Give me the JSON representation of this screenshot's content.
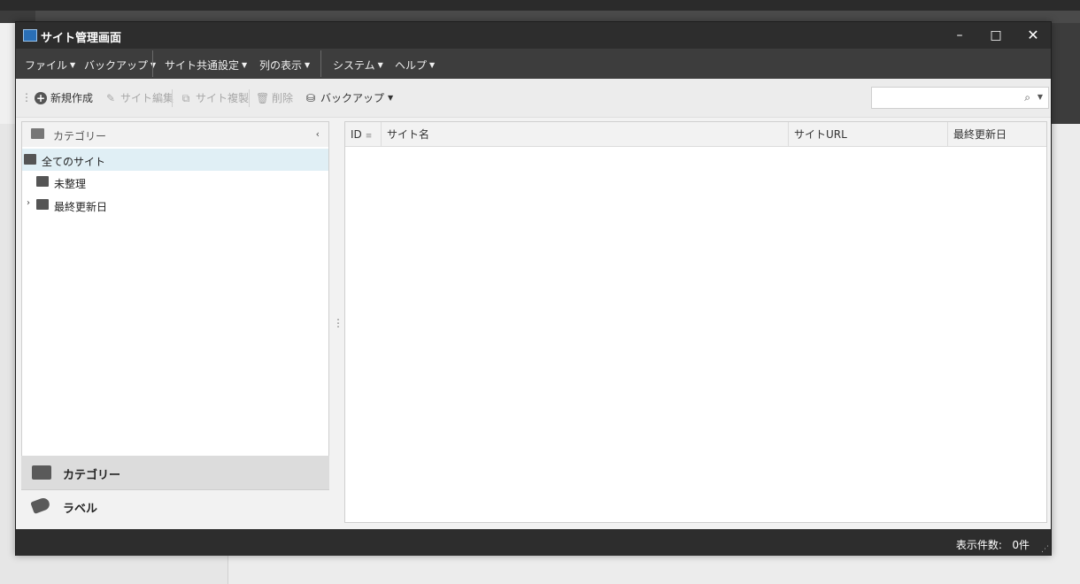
{
  "window": {
    "title": "サイト管理画面",
    "minimize": "–",
    "maximize": "□",
    "close": "✕"
  },
  "menu": {
    "items": [
      {
        "label": "ファイル"
      },
      {
        "label": "バックアップ"
      },
      {
        "label": "サイト共通設定"
      },
      {
        "label": "列の表示"
      },
      {
        "label": "システム"
      },
      {
        "label": "ヘルプ"
      }
    ]
  },
  "toolbar": {
    "new_label": "新規作成",
    "edit_label": "サイト編集",
    "copy_label": "サイト複製",
    "delete_label": "削除",
    "backup_label": "バックアップ",
    "search_placeholder": ""
  },
  "category_panel": {
    "header": "カテゴリー",
    "tree": [
      {
        "label": "全てのサイト",
        "selected": true
      },
      {
        "label": "未整理",
        "selected": false
      },
      {
        "label": "最終更新日",
        "selected": false
      }
    ],
    "footer_tabs": [
      {
        "label": "カテゴリー",
        "active": true
      },
      {
        "label": "ラベル",
        "active": false
      }
    ]
  },
  "grid": {
    "columns": [
      "ID",
      "サイト名",
      "サイトURL",
      "最終更新日"
    ],
    "rows": []
  },
  "status": {
    "count_label": "表示件数:",
    "count_value": "0件"
  },
  "colors": {
    "titlebar": "#2d2d2d",
    "menubar": "#3d3d3d",
    "selected_row": "#e0eff5"
  }
}
